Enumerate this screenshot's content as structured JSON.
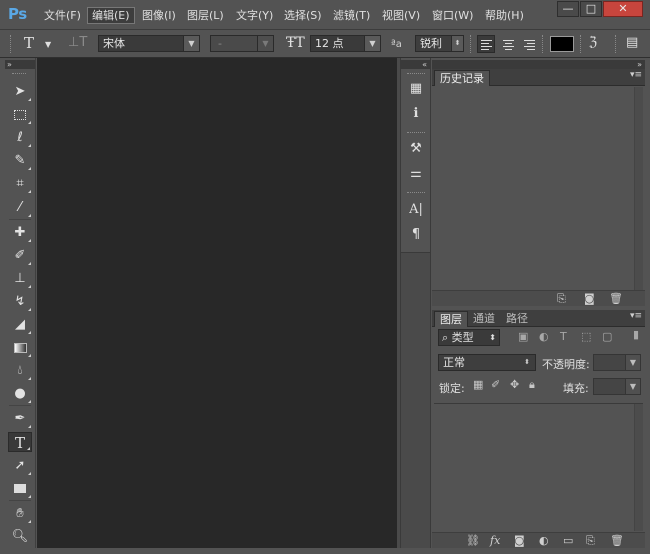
{
  "app": {
    "logo": "Ps"
  },
  "menu": [
    "文件(F)",
    "编辑(E)",
    "图像(I)",
    "图层(L)",
    "文字(Y)",
    "选择(S)",
    "滤镜(T)",
    "视图(V)",
    "窗口(W)",
    "帮助(H)"
  ],
  "window_controls": {
    "minimize": "—",
    "maximize": "□",
    "close": "✕"
  },
  "options": {
    "tool_glyph": "T",
    "font_family": "宋体",
    "font_style": "-",
    "font_size": "12 点",
    "aa_label": "ªa",
    "antialias": "锐利",
    "text_color": "#000000"
  },
  "panels": {
    "history": {
      "tab": "历史记录"
    },
    "layers": {
      "tabs": [
        "图层",
        "通道",
        "路径"
      ],
      "filter_kind": "类型",
      "blend_mode": "正常",
      "opacity_label": "不透明度:",
      "lock_label": "锁定:",
      "fill_label": "填充:"
    }
  },
  "colors": {
    "accent": "#5aa8e6",
    "panel_bg": "#535353",
    "canvas_bg": "#282828",
    "close_btn": "#c7453d"
  }
}
